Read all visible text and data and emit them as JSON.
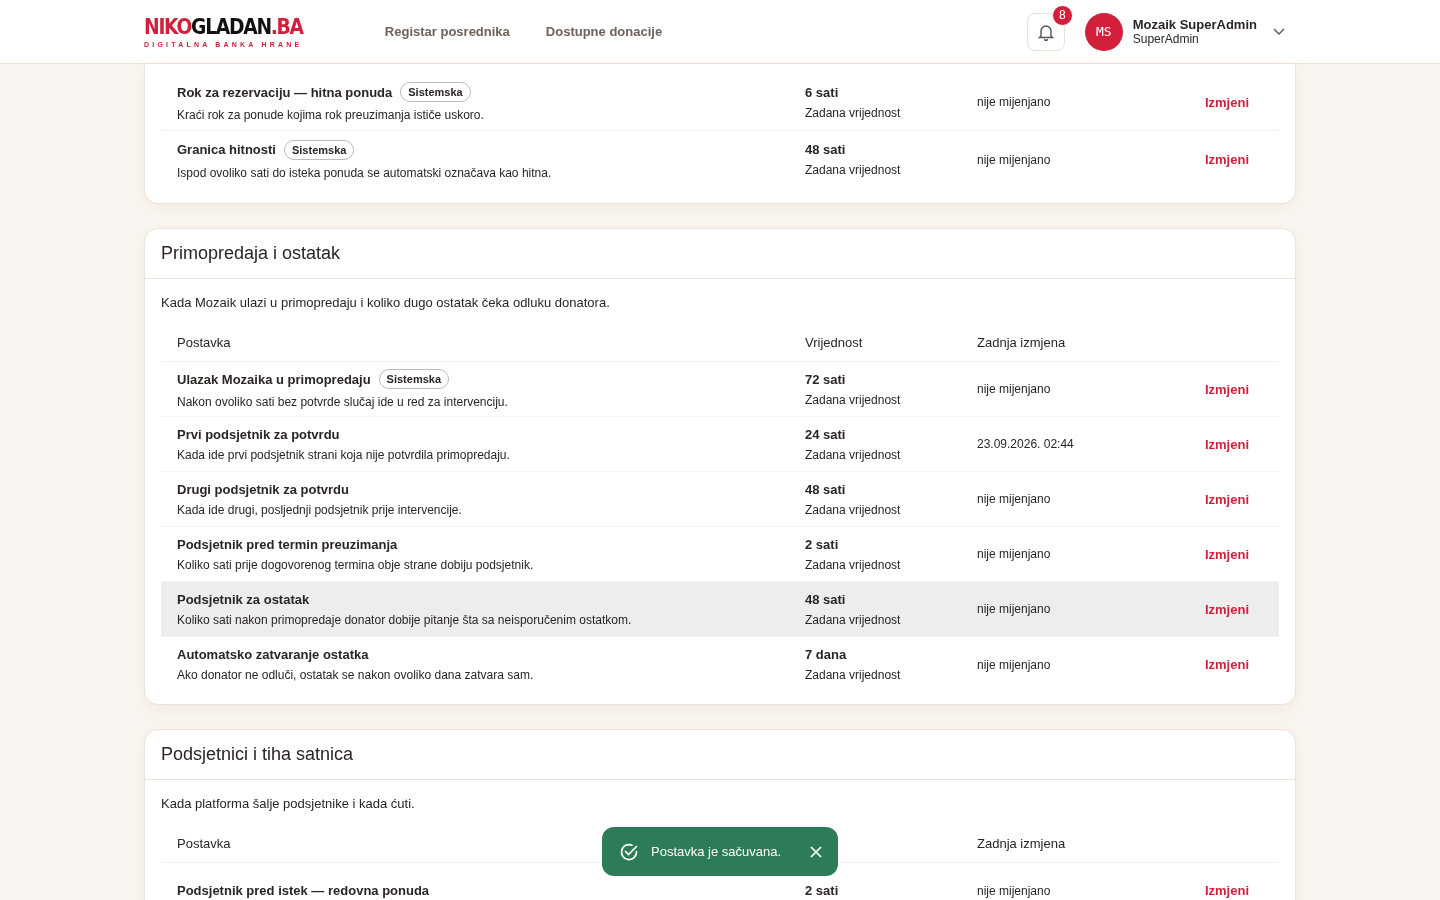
{
  "header": {
    "logo": {
      "part1": "NIKO",
      "part2": "GLADAN",
      "part3": ".BA",
      "tagline": "DIGITALNA BANKA HRANE"
    },
    "nav": [
      {
        "label": "Registar posrednika",
        "selected": false
      },
      {
        "label": "Dostupne donacije",
        "selected": false
      }
    ],
    "notifications": {
      "count": "8"
    },
    "user": {
      "initials": "MS",
      "name": "Mozaik SuperAdmin",
      "role": "SuperAdmin"
    }
  },
  "cards": [
    {
      "rows": [
        {
          "name": "Rok za rezervaciju — hitna ponuda",
          "badge": "Sistemska",
          "desc": "Kraći rok za ponude kojima rok preuzimanja ističe uskoro.",
          "value": "6 sati",
          "value_note": "Zadana vrijednost",
          "changed": "nije mijenjano",
          "action": "Izmjeni",
          "selected": false
        },
        {
          "name": "Granica hitnosti",
          "badge": "Sistemska",
          "desc": "Ispod ovoliko sati do isteka ponuda se automatski označava kao hitna.",
          "value": "48 sati",
          "value_note": "Zadana vrijednost",
          "changed": "nije mijenjano",
          "action": "Izmjeni",
          "selected": false
        }
      ]
    },
    {
      "title": "Primopredaja i ostatak",
      "intro": "Kada Mozaik ulazi u primopredaju i koliko dugo ostatak čeka odluku donatora.",
      "columns": [
        "Postavka",
        "Vrijednost",
        "Zadnja izmjena"
      ],
      "rows": [
        {
          "name": "Ulazak Mozaika u primopredaju",
          "badge": "Sistemska",
          "desc": "Nakon ovoliko sati bez potvrde slučaj ide u red za intervenciju.",
          "value": "72 sati",
          "value_note": "Zadana vrijednost",
          "changed": "nije mijenjano",
          "action": "Izmjeni",
          "selected": false
        },
        {
          "name": "Prvi podsjetnik za potvrdu",
          "desc": "Kada ide prvi podsjetnik strani koja nije potvrdila primopredaju.",
          "value": "24 sati",
          "value_note": "Zadana vrijednost",
          "changed": "23.09.2026. 02:44",
          "action": "Izmjeni",
          "selected": false
        },
        {
          "name": "Drugi podsjetnik za potvrdu",
          "desc": "Kada ide drugi, posljednji podsjetnik prije intervencije.",
          "value": "48 sati",
          "value_note": "Zadana vrijednost",
          "changed": "nije mijenjano",
          "action": "Izmjeni",
          "selected": false
        },
        {
          "name": "Podsjetnik pred termin preuzimanja",
          "desc": "Koliko sati prije dogovorenog termina obje strane dobiju podsjetnik.",
          "value": "2 sati",
          "value_note": "Zadana vrijednost",
          "changed": "nije mijenjano",
          "action": "Izmjeni",
          "selected": false
        },
        {
          "name": "Podsjetnik za ostatak",
          "desc": "Koliko sati nakon primopredaje donator dobije pitanje šta sa neisporučenim ostatkom.",
          "value": "48 sati",
          "value_note": "Zadana vrijednost",
          "changed": "nije mijenjano",
          "action": "Izmjeni",
          "selected": true
        },
        {
          "name": "Automatsko zatvaranje ostatka",
          "desc": "Ako donator ne odluči, ostatak se nakon ovoliko dana zatvara sam.",
          "value": "7 dana",
          "value_note": "Zadana vrijednost",
          "changed": "nije mijenjano",
          "action": "Izmjeni",
          "selected": false
        }
      ]
    },
    {
      "title": "Podsjetnici i tiha satnica",
      "intro": "Kada platforma šalje podsjetnike i kada ćuti.",
      "columns": [
        "Postavka",
        "Zadnja izmjena"
      ],
      "rows": [
        {
          "name": "Podsjetnik pred istek — redovna ponuda",
          "value": "2 sati",
          "changed": "nije mijenjano",
          "action": "Izmjeni",
          "selected": false
        }
      ]
    }
  ],
  "toast": {
    "message": "Postavka je sačuvana."
  }
}
